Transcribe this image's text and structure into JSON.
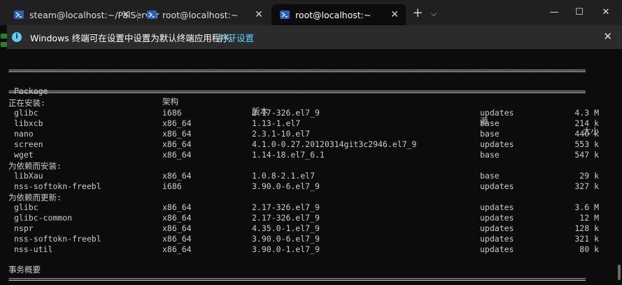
{
  "tabs": [
    {
      "label": "steam@localhost:~/PalServer",
      "active": false
    },
    {
      "label": "root@localhost:~",
      "active": false
    },
    {
      "label": "root@localhost:~",
      "active": true
    }
  ],
  "window_controls": {
    "minimize": "—",
    "maximize": "☐",
    "close": "✕"
  },
  "notice": {
    "message": "Windows 终端可在设置中设置为默认终端应用程序。",
    "link": "打开设置"
  },
  "terminal": {
    "rule": "================================================================================================================================================",
    "headers": {
      "package": "Package",
      "arch": "架构",
      "version": "版本",
      "repo": "源",
      "size": "大小"
    },
    "sections": [
      {
        "title": "正在安装:",
        "rows": [
          {
            "package": "glibc",
            "arch": "i686",
            "version": "2.17-326.el7_9",
            "repo": "updates",
            "size": "4.3 M"
          },
          {
            "package": "libxcb",
            "arch": "x86_64",
            "version": "1.13-1.el7",
            "repo": "base",
            "size": "214 k"
          },
          {
            "package": "nano",
            "arch": "x86_64",
            "version": "2.3.1-10.el7",
            "repo": "base",
            "size": "440 k"
          },
          {
            "package": "screen",
            "arch": "x86_64",
            "version": "4.1.0-0.27.20120314git3c2946.el7_9",
            "repo": "updates",
            "size": "553 k"
          },
          {
            "package": "wget",
            "arch": "x86_64",
            "version": "1.14-18.el7_6.1",
            "repo": "base",
            "size": "547 k"
          }
        ]
      },
      {
        "title": "为依赖而安装:",
        "rows": [
          {
            "package": "libXau",
            "arch": "x86_64",
            "version": "1.0.8-2.1.el7",
            "repo": "base",
            "size": "29 k"
          },
          {
            "package": "nss-softokn-freebl",
            "arch": "i686",
            "version": "3.90.0-6.el7_9",
            "repo": "updates",
            "size": "327 k"
          }
        ]
      },
      {
        "title": "为依赖而更新:",
        "rows": [
          {
            "package": "glibc",
            "arch": "x86_64",
            "version": "2.17-326.el7_9",
            "repo": "updates",
            "size": "3.6 M"
          },
          {
            "package": "glibc-common",
            "arch": "x86_64",
            "version": "2.17-326.el7_9",
            "repo": "updates",
            "size": "12 M"
          },
          {
            "package": "nspr",
            "arch": "x86_64",
            "version": "4.35.0-1.el7_9",
            "repo": "updates",
            "size": "128 k"
          },
          {
            "package": "nss-softokn-freebl",
            "arch": "x86_64",
            "version": "3.90.0-6.el7_9",
            "repo": "updates",
            "size": "321 k"
          },
          {
            "package": "nss-util",
            "arch": "x86_64",
            "version": "3.90.0-1.el7_9",
            "repo": "updates",
            "size": "80 k"
          }
        ]
      }
    ],
    "summary": "事务概要"
  }
}
